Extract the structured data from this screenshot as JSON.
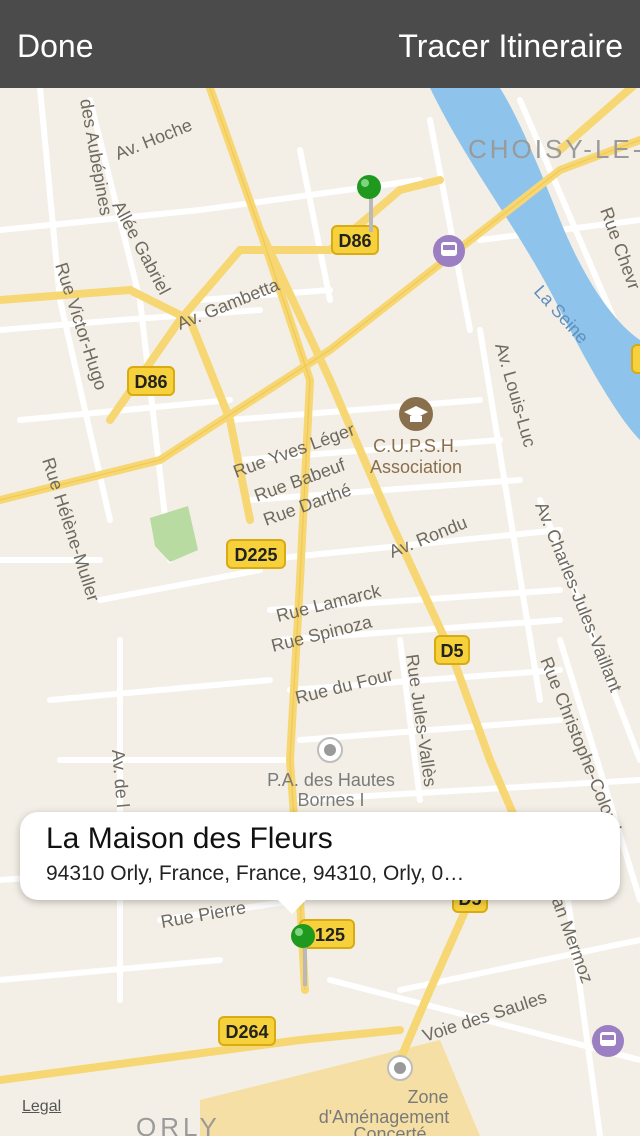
{
  "toolbar": {
    "done_label": "Done",
    "route_label": "Tracer Itineraire"
  },
  "callout": {
    "title": "La Maison des Fleurs",
    "subtitle": "94310 Orly, France, France, 94310, Orly, 0…"
  },
  "map": {
    "legal": "Legal",
    "city_choisy": "CHOISY-LE-",
    "city_orly": "ORLY",
    "river": "La Seine",
    "poi_cupsh_1": "C.U.P.S.H.",
    "poi_cupsh_2": "Association",
    "poi_pa_1": "P.A. des Hautes",
    "poi_pa_2": "Bornes I",
    "poi_zone_1": "Zone",
    "poi_zone_2": "d'Aménagement",
    "poi_zone_3": "Concerté",
    "shields": {
      "d86_a": "D86",
      "d86_b": "D86",
      "d225": "D225",
      "d5": "D5",
      "d125": "125",
      "d264": "D264",
      "d5b": "D5"
    },
    "streets": {
      "hoche": "Av. Hoche",
      "aubepines": "des Aubépines",
      "gabriel": "Allée Gabriel",
      "gambetta": "Av. Gambetta",
      "victor_hugo": "Rue Victor-Hugo",
      "helene": "Rue Hélène-Muller",
      "yves": "Rue Yves Léger",
      "babeuf": "Rue Babeuf",
      "darthe": "Rue Darthé",
      "rondu": "Av. Rondu",
      "lamarck": "Rue Lamarck",
      "spinoza": "Rue Spinoza",
      "four": "Rue du Four",
      "valles": "Rue Jules-Vallès",
      "louis_luc": "Av. Louis-Luc",
      "vaillant": "Av. Charles-Jules-Vaillant",
      "christophe": "Rue Christophe-Colomb",
      "mermoz": "Jean Mermoz",
      "saules": "Voie des Saules",
      "pierre": "Rue Pierre",
      "chevre": "Rue Chevr",
      "ave_de": "Av. de l"
    }
  },
  "colors": {
    "bar": "#4b4b4b",
    "land": "#f3efe6",
    "road_major": "#f7d774",
    "water": "#8ec3ec",
    "park": "#b7dba0",
    "pin": "#1f9a1f",
    "transit": "#9b7fc2"
  }
}
